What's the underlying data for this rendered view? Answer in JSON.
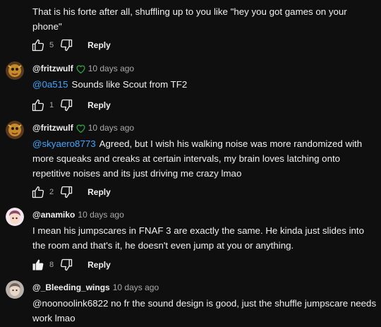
{
  "comments": [
    {
      "author": "",
      "time": "",
      "mention": "",
      "text": "That is his forte after all, shuffling up to you like \"hey you got games on your phone\"",
      "likes": "5",
      "liked": false,
      "reply_label": "Reply"
    },
    {
      "author": "@fritzwulf",
      "time": "10 days ago",
      "mention": "@0a515",
      "text": "Sounds like Scout from TF2",
      "likes": "1",
      "liked": false,
      "reply_label": "Reply"
    },
    {
      "author": "@fritzwulf",
      "time": "10 days ago",
      "mention": "@skyaero8773",
      "text": "Agreed, but I wish his walking noise was more randomized with more squeaks and creaks at certain intervals, my brain loves latching onto repetitive noises and its just driving me crazy lmao",
      "likes": "2",
      "liked": false,
      "reply_label": "Reply"
    },
    {
      "author": "@anamiko",
      "time": "10 days ago",
      "mention": "",
      "text": "I mean his jumpscares in FNAF 3 are exactly the same. He kinda just slides into the room and that's it, he doesn't even jump at you or anything.",
      "likes": "8",
      "liked": true,
      "reply_label": "Reply"
    },
    {
      "author": "@_Bleeding_wings",
      "time": "10 days ago",
      "mention": "",
      "text": "@noonoolink6822  no fr the sound design is good, just the shuffle jumpscare needs work lmao",
      "likes": "",
      "liked": false,
      "reply_label": ""
    }
  ],
  "colors": {
    "background": "#0f0f0f",
    "text": "#f1f1f1",
    "secondary": "#aaaaaa",
    "link": "#3ea6ff",
    "heart": "#2ba640"
  }
}
